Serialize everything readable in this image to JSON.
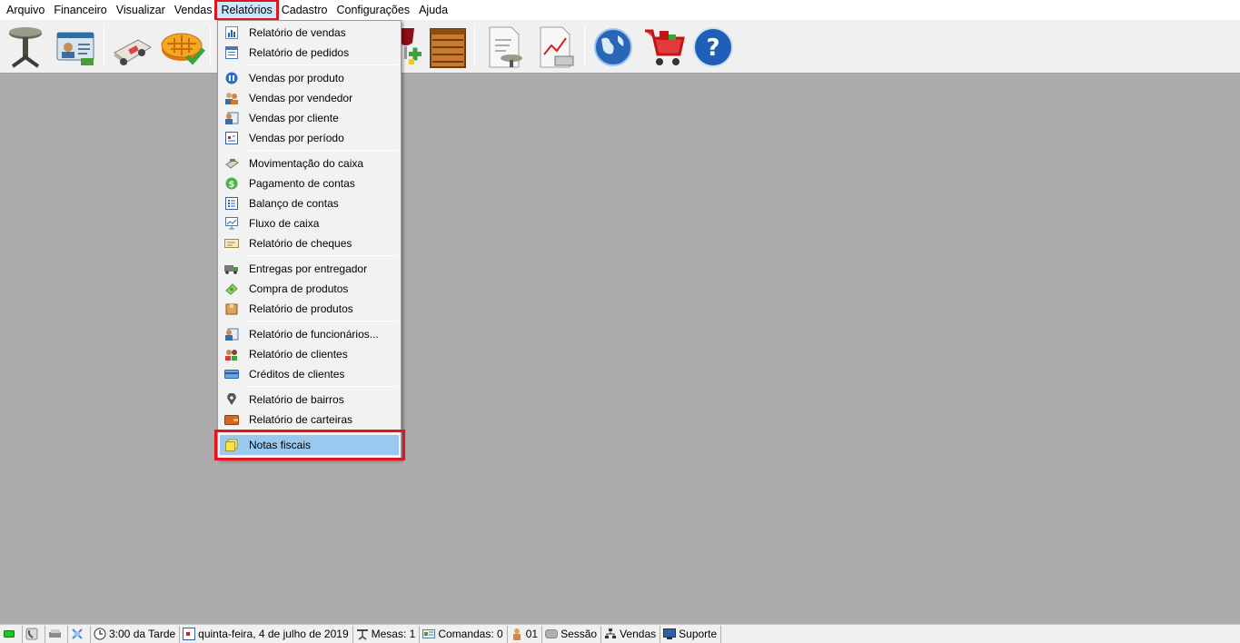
{
  "menubar": {
    "items": [
      "Arquivo",
      "Financeiro",
      "Visualizar",
      "Vendas",
      "Relatórios",
      "Cadastro",
      "Configurações",
      "Ajuda"
    ],
    "active": "Relatórios"
  },
  "toolbar": {
    "buttons": [
      "table-icon",
      "customer-card-icon",
      "delivery-truck-icon",
      "pie-check-icon",
      "wine-add-icon",
      "crate-icon",
      "report-table-icon",
      "report-chart-icon",
      "globe-icon",
      "shopping-cart-icon",
      "help-icon"
    ]
  },
  "menu": {
    "items": [
      {
        "label": "Relatório de vendas",
        "icon": "bar-chart-icon"
      },
      {
        "label": "Relatório de pedidos",
        "icon": "list-window-icon"
      },
      {
        "label": "Vendas por produto",
        "icon": "product-circle-icon"
      },
      {
        "label": "Vendas por vendedor",
        "icon": "sellers-icon"
      },
      {
        "label": "Vendas por cliente",
        "icon": "client-card-icon"
      },
      {
        "label": "Vendas por período",
        "icon": "calendar-icon"
      },
      {
        "label": "Movimentação do caixa",
        "icon": "cash-register-icon"
      },
      {
        "label": "Pagamento de contas",
        "icon": "dollar-coin-icon"
      },
      {
        "label": "Balanço de contas",
        "icon": "checklist-icon"
      },
      {
        "label": "Fluxo de caixa",
        "icon": "presentation-chart-icon"
      },
      {
        "label": "Relatório de cheques",
        "icon": "cheque-icon"
      },
      {
        "label": "Entregas por entregador",
        "icon": "truck-icon"
      },
      {
        "label": "Compra de produtos",
        "icon": "money-icon"
      },
      {
        "label": "Relatório de produtos",
        "icon": "box-icon"
      },
      {
        "label": "Relatório de funcionários...",
        "icon": "employee-card-icon"
      },
      {
        "label": "Relatório de clientes",
        "icon": "clients-icon"
      },
      {
        "label": "Créditos de clientes",
        "icon": "credit-icon"
      },
      {
        "label": "Relatório de bairros",
        "icon": "location-pin-icon"
      },
      {
        "label": "Relatório de carteiras",
        "icon": "wallet-icon"
      },
      {
        "label": "Notas fiscais",
        "icon": "notes-icon"
      }
    ],
    "highlighted": "Notas fiscais"
  },
  "statusbar": {
    "time": "3:00 da Tarde",
    "date": "quinta-feira, 4 de julho de 2019",
    "mesas": "Mesas: 1",
    "comandas": "Comandas: 0",
    "user": "01",
    "session": "Sessão",
    "vendas": "Vendas",
    "suporte": "Suporte"
  },
  "colors": {
    "highlight_border": "#e0161f",
    "selected_item": "#99c9ef",
    "workspace": "#ababab"
  }
}
